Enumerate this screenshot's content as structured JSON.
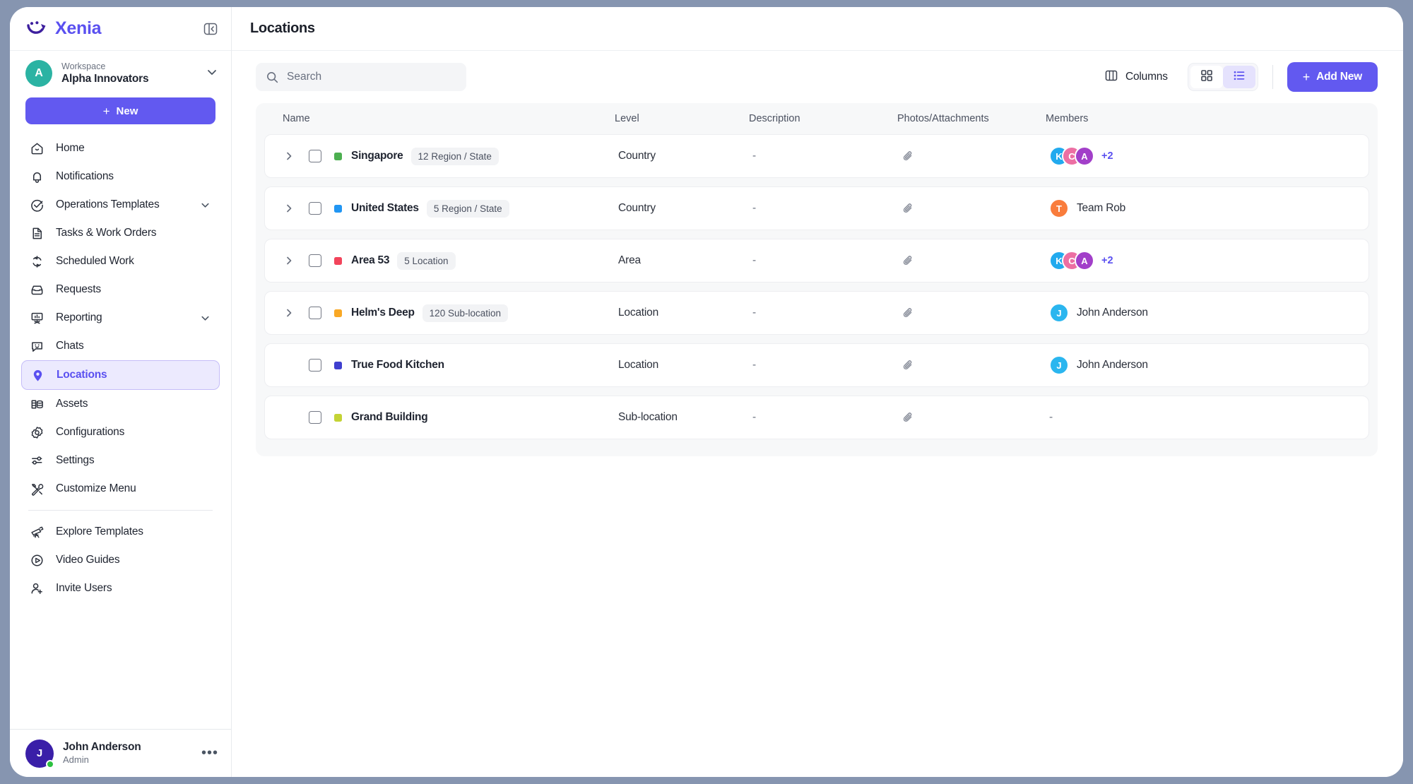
{
  "brand": {
    "name": "Xenia",
    "logo_icon": "xenia-smile-logo",
    "collapse_icon": "sidebar-collapse-icon"
  },
  "workspace": {
    "label": "Workspace",
    "name": "Alpha Innovators",
    "avatar_initial": "A",
    "avatar_color": "#2bb3a3",
    "chevron_icon": "chevron-down-icon"
  },
  "new_button": {
    "label": "New",
    "plus": "+",
    "color": "#6259f0"
  },
  "nav": {
    "items": [
      {
        "label": "Home",
        "icon": "home-icon",
        "active": false,
        "caret": false
      },
      {
        "label": "Notifications",
        "icon": "bell-icon",
        "active": false,
        "caret": false
      },
      {
        "label": "Operations Templates",
        "icon": "check-circle-icon",
        "active": false,
        "caret": true
      },
      {
        "label": "Tasks & Work Orders",
        "icon": "document-list-icon",
        "active": false,
        "caret": false
      },
      {
        "label": "Scheduled Work",
        "icon": "refresh-cycle-icon",
        "active": false,
        "caret": false
      },
      {
        "label": "Requests",
        "icon": "inbox-icon",
        "active": false,
        "caret": false
      },
      {
        "label": "Reporting",
        "icon": "presentation-chart-icon",
        "active": false,
        "caret": true
      },
      {
        "label": "Chats",
        "icon": "chat-smile-icon",
        "active": false,
        "caret": false
      },
      {
        "label": "Locations",
        "icon": "map-pin-icon",
        "active": true,
        "caret": false
      },
      {
        "label": "Assets",
        "icon": "database-stack-icon",
        "active": false,
        "caret": false
      },
      {
        "label": "Configurations",
        "icon": "gear-icon",
        "active": false,
        "caret": false
      },
      {
        "label": "Settings",
        "icon": "sliders-icon",
        "active": false,
        "caret": false
      },
      {
        "label": "Customize Menu",
        "icon": "wrench-screwdriver-icon",
        "active": false,
        "caret": false
      }
    ],
    "secondary_items": [
      {
        "label": "Explore Templates",
        "icon": "telescope-icon"
      },
      {
        "label": "Video Guides",
        "icon": "play-circle-icon"
      },
      {
        "label": "Invite Users",
        "icon": "user-plus-icon"
      }
    ]
  },
  "current_user": {
    "name": "John Anderson",
    "role": "Admin",
    "avatar_initial": "J",
    "avatar_color": "#3a1fa8",
    "status_color": "#2cc13f",
    "more_icon": "ellipsis-icon"
  },
  "header": {
    "title": "Locations"
  },
  "search": {
    "placeholder": "Search",
    "value": "",
    "icon": "search-icon"
  },
  "toolbar": {
    "columns_label": "Columns",
    "columns_icon": "columns-icon",
    "grid_view_icon": "grid-view-icon",
    "list_view_icon": "list-view-icon",
    "active_view": "list",
    "add_new_label": "Add New",
    "add_new_plus": "+",
    "accent_color": "#6259f0"
  },
  "table": {
    "columns": [
      "Name",
      "Level",
      "Description",
      "Photos/Attachments",
      "Members"
    ],
    "rows": [
      {
        "name": "Singapore",
        "color": "#4caf50",
        "chip": "12 Region / State",
        "level": "Country",
        "description": "-",
        "attachment_icon": "paperclip-icon",
        "expandable": true,
        "checked": false,
        "members_type": "stack",
        "members": [
          {
            "initial": "K",
            "color": "#22aaee"
          },
          {
            "initial": "C",
            "color": "#ec6fa3"
          },
          {
            "initial": "A",
            "color": "#a23fc9"
          }
        ],
        "members_more": "+2",
        "member_name": ""
      },
      {
        "name": "United States",
        "color": "#2196f3",
        "chip": "5 Region / State",
        "level": "Country",
        "description": "-",
        "attachment_icon": "paperclip-icon",
        "expandable": true,
        "checked": false,
        "members_type": "single",
        "members": [
          {
            "initial": "T",
            "color": "#f97c3c"
          }
        ],
        "members_more": "",
        "member_name": "Team Rob"
      },
      {
        "name": "Area 53",
        "color": "#f2445b",
        "chip": "5 Location",
        "level": "Area",
        "description": "-",
        "attachment_icon": "paperclip-icon",
        "expandable": true,
        "checked": false,
        "members_type": "stack",
        "members": [
          {
            "initial": "K",
            "color": "#22aaee"
          },
          {
            "initial": "C",
            "color": "#ec6fa3"
          },
          {
            "initial": "A",
            "color": "#a23fc9"
          }
        ],
        "members_more": "+2",
        "member_name": ""
      },
      {
        "name": "Helm's Deep",
        "color": "#f9a825",
        "chip": "120 Sub-location",
        "level": "Location",
        "description": "-",
        "attachment_icon": "paperclip-icon",
        "expandable": true,
        "checked": false,
        "members_type": "single",
        "members": [
          {
            "initial": "J",
            "color": "#2bb6ef"
          }
        ],
        "members_more": "",
        "member_name": "John Anderson"
      },
      {
        "name": "True Food Kitchen",
        "color": "#3f3fcf",
        "chip": "",
        "level": "Location",
        "description": "-",
        "attachment_icon": "paperclip-icon",
        "expandable": false,
        "checked": false,
        "members_type": "single",
        "members": [
          {
            "initial": "J",
            "color": "#2bb6ef"
          }
        ],
        "members_more": "",
        "member_name": "John Anderson"
      },
      {
        "name": "Grand Building",
        "color": "#c4d335",
        "chip": "",
        "level": "Sub-location",
        "description": "-",
        "attachment_icon": "paperclip-icon",
        "expandable": false,
        "checked": false,
        "members_type": "none",
        "members": [],
        "members_more": "",
        "member_name": "-"
      }
    ]
  }
}
